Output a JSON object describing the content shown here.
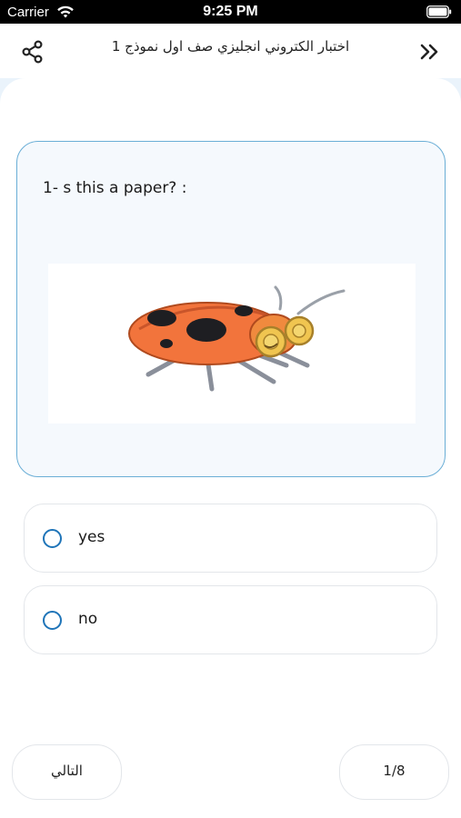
{
  "status_bar": {
    "carrier": "Carrier",
    "time": "9:25 PM"
  },
  "header": {
    "title": "اختبار الكتروني انجليزي صف اول نموذج 1",
    "share_icon": "share-icon",
    "forward_icon": "double-chevron-right-icon"
  },
  "question": {
    "text": "1- s this a paper? :",
    "image": "ladybug-illustration"
  },
  "options": [
    {
      "label": "yes",
      "selected": false
    },
    {
      "label": "no",
      "selected": false
    }
  ],
  "footer": {
    "next_label": "التالي",
    "page_counter": "1/8"
  },
  "colors": {
    "accent": "#1e74b8",
    "card_border": "#6aaed6",
    "card_bg": "#f5f9fd"
  }
}
